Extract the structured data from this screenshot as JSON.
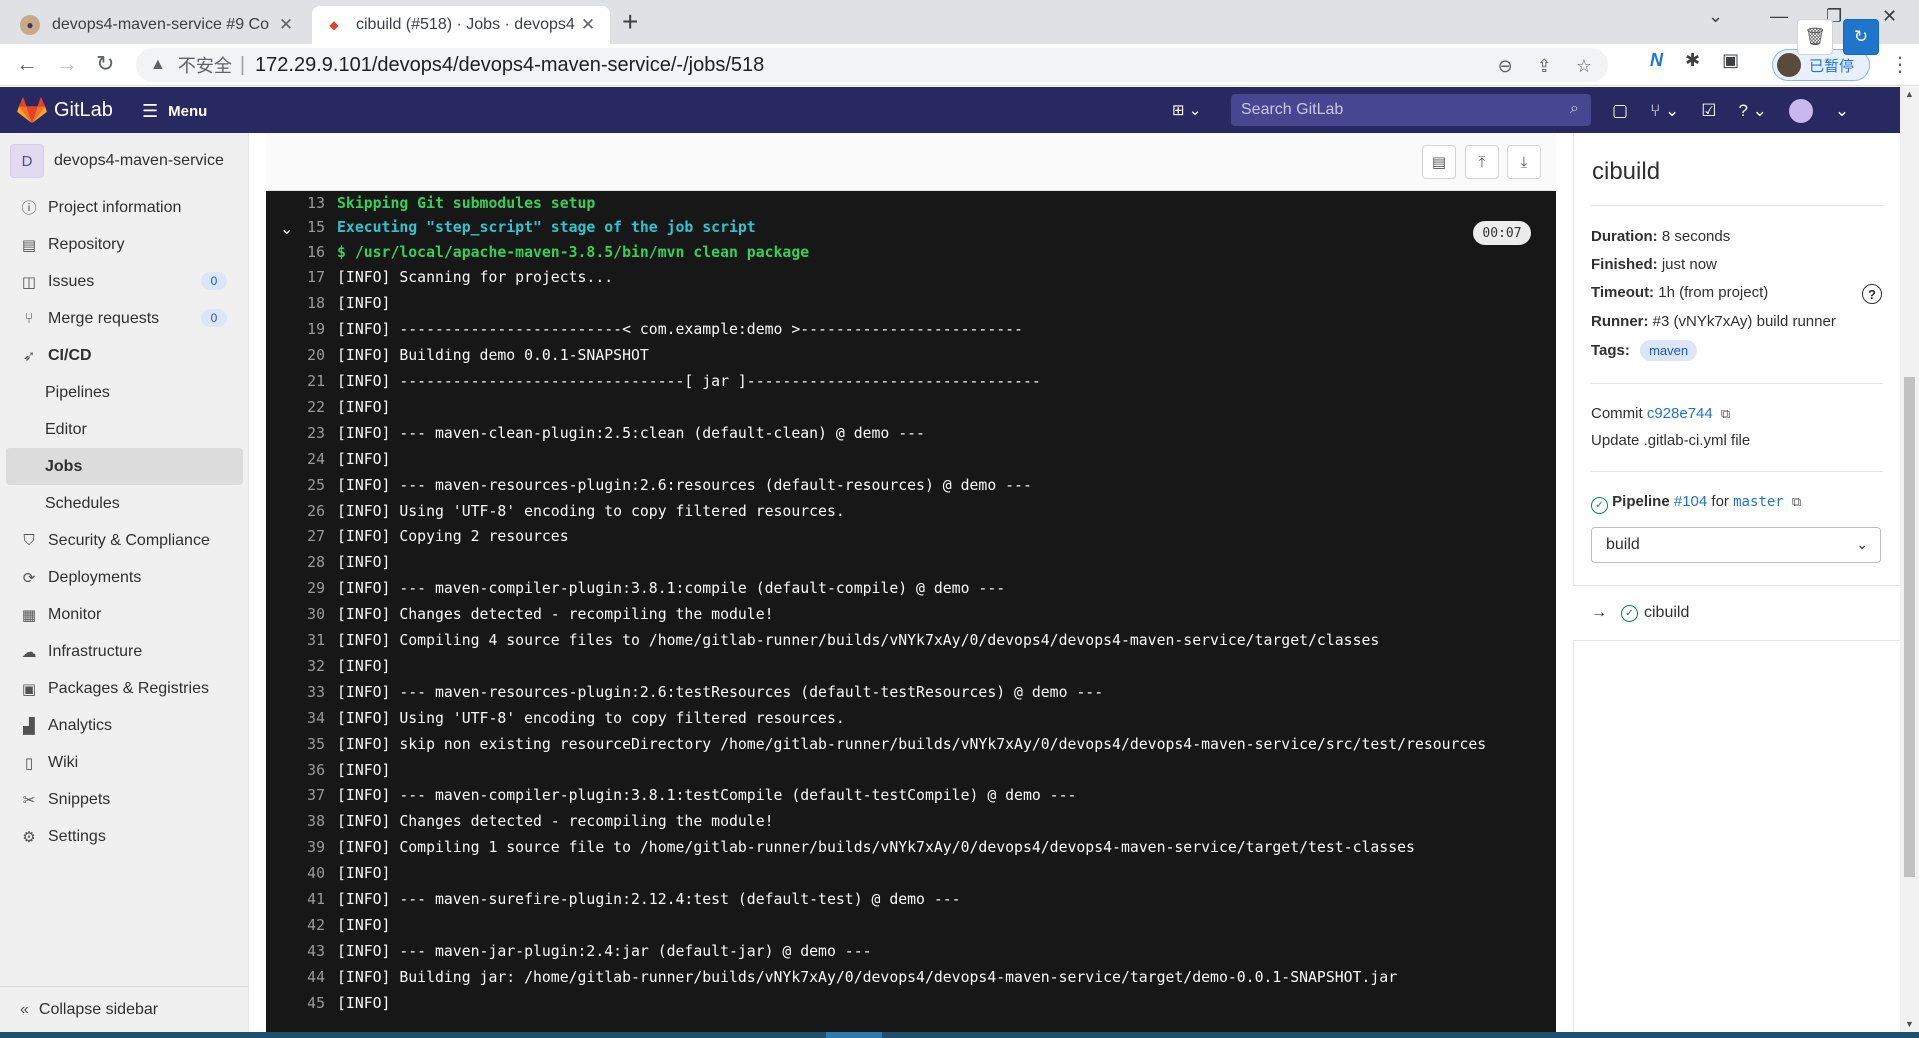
{
  "browser": {
    "tabs": [
      {
        "title": "devops4-maven-service #9 Co",
        "active": false
      },
      {
        "title": "cibuild (#518) · Jobs · devops4",
        "active": true
      }
    ],
    "address": {
      "security_label": "不安全",
      "url": "172.29.9.101/devops4/devops4-maven-service/-/jobs/518"
    },
    "profile_status": "已暂停"
  },
  "header": {
    "brand": "GitLab",
    "menu_label": "Menu",
    "search_placeholder": "Search GitLab"
  },
  "sidebar": {
    "project_initial": "D",
    "project_name": "devops4-maven-service",
    "items": [
      {
        "label": "Project information",
        "icon": "info-icon"
      },
      {
        "label": "Repository",
        "icon": "doc-icon"
      },
      {
        "label": "Issues",
        "icon": "issues-icon",
        "count": "0"
      },
      {
        "label": "Merge requests",
        "icon": "merge-request-icon",
        "count": "0"
      },
      {
        "label": "CI/CD",
        "icon": "rocket-icon"
      },
      {
        "label": "Pipelines"
      },
      {
        "label": "Editor"
      },
      {
        "label": "Jobs"
      },
      {
        "label": "Schedules"
      },
      {
        "label": "Security & Compliance",
        "icon": "shield-icon"
      },
      {
        "label": "Deployments",
        "icon": "deployments-icon"
      },
      {
        "label": "Monitor",
        "icon": "monitor-icon"
      },
      {
        "label": "Infrastructure",
        "icon": "cloud-icon"
      },
      {
        "label": "Packages & Registries",
        "icon": "package-icon"
      },
      {
        "label": "Analytics",
        "icon": "chart-icon"
      },
      {
        "label": "Wiki",
        "icon": "book-icon"
      },
      {
        "label": "Snippets",
        "icon": "scissors-icon"
      },
      {
        "label": "Settings",
        "icon": "gear-icon"
      }
    ],
    "collapse_label": "Collapse sidebar"
  },
  "log": {
    "section_duration": "00:07",
    "lines": [
      {
        "n": "13",
        "text": "Skipping Git submodules setup",
        "style": "green"
      },
      {
        "n": "15",
        "text": "Executing \"step_script\" stage of the job script",
        "style": "cyan"
      },
      {
        "n": "16",
        "text": "$ /usr/local/apache-maven-3.8.5/bin/mvn clean package",
        "style": "cmd"
      },
      {
        "n": "17",
        "text": "[INFO] Scanning for projects..."
      },
      {
        "n": "18",
        "text": "[INFO]"
      },
      {
        "n": "19",
        "text": "[INFO] -------------------------< com.example:demo >-------------------------"
      },
      {
        "n": "20",
        "text": "[INFO] Building demo 0.0.1-SNAPSHOT"
      },
      {
        "n": "21",
        "text": "[INFO] --------------------------------[ jar ]---------------------------------"
      },
      {
        "n": "22",
        "text": "[INFO]"
      },
      {
        "n": "23",
        "text": "[INFO] --- maven-clean-plugin:2.5:clean (default-clean) @ demo ---"
      },
      {
        "n": "24",
        "text": "[INFO]"
      },
      {
        "n": "25",
        "text": "[INFO] --- maven-resources-plugin:2.6:resources (default-resources) @ demo ---"
      },
      {
        "n": "26",
        "text": "[INFO] Using 'UTF-8' encoding to copy filtered resources."
      },
      {
        "n": "27",
        "text": "[INFO] Copying 2 resources"
      },
      {
        "n": "28",
        "text": "[INFO]"
      },
      {
        "n": "29",
        "text": "[INFO] --- maven-compiler-plugin:3.8.1:compile (default-compile) @ demo ---"
      },
      {
        "n": "30",
        "text": "[INFO] Changes detected - recompiling the module!"
      },
      {
        "n": "31",
        "text": "[INFO] Compiling 4 source files to /home/gitlab-runner/builds/vNYk7xAy/0/devops4/devops4-maven-service/target/classes"
      },
      {
        "n": "32",
        "text": "[INFO]"
      },
      {
        "n": "33",
        "text": "[INFO] --- maven-resources-plugin:2.6:testResources (default-testResources) @ demo ---"
      },
      {
        "n": "34",
        "text": "[INFO] Using 'UTF-8' encoding to copy filtered resources."
      },
      {
        "n": "35",
        "text": "[INFO] skip non existing resourceDirectory /home/gitlab-runner/builds/vNYk7xAy/0/devops4/devops4-maven-service/src/test/resources"
      },
      {
        "n": "36",
        "text": "[INFO]"
      },
      {
        "n": "37",
        "text": "[INFO] --- maven-compiler-plugin:3.8.1:testCompile (default-testCompile) @ demo ---"
      },
      {
        "n": "38",
        "text": "[INFO] Changes detected - recompiling the module!"
      },
      {
        "n": "39",
        "text": "[INFO] Compiling 1 source file to /home/gitlab-runner/builds/vNYk7xAy/0/devops4/devops4-maven-service/target/test-classes"
      },
      {
        "n": "40",
        "text": "[INFO]"
      },
      {
        "n": "41",
        "text": "[INFO] --- maven-surefire-plugin:2.12.4:test (default-test) @ demo ---"
      },
      {
        "n": "42",
        "text": "[INFO]"
      },
      {
        "n": "43",
        "text": "[INFO] --- maven-jar-plugin:2.4:jar (default-jar) @ demo ---"
      },
      {
        "n": "44",
        "text": "[INFO] Building jar: /home/gitlab-runner/builds/vNYk7xAy/0/devops4/devops4-maven-service/target/demo-0.0.1-SNAPSHOT.jar"
      },
      {
        "n": "45",
        "text": "[INFO]"
      }
    ]
  },
  "job": {
    "title": "cibuild",
    "duration_label": "Duration:",
    "duration": "8 seconds",
    "finished_label": "Finished:",
    "finished": "just now",
    "timeout_label": "Timeout:",
    "timeout": "1h (from project)",
    "runner_label": "Runner:",
    "runner": "#3 (vNYk7xAy) build runner",
    "tags_label": "Tags:",
    "tag": "maven",
    "commit_label": "Commit",
    "commit_sha": "c928e744",
    "commit_message": "Update .gitlab-ci.yml file",
    "pipeline_label": "Pipeline",
    "pipeline_id": "#104",
    "pipeline_for": "for",
    "pipeline_ref": "master",
    "stage": "build",
    "job_name": "cibuild"
  },
  "colors": {
    "header": "#292961",
    "log_bg": "#171717",
    "accent": "#1f75cb",
    "success": "#108548"
  }
}
